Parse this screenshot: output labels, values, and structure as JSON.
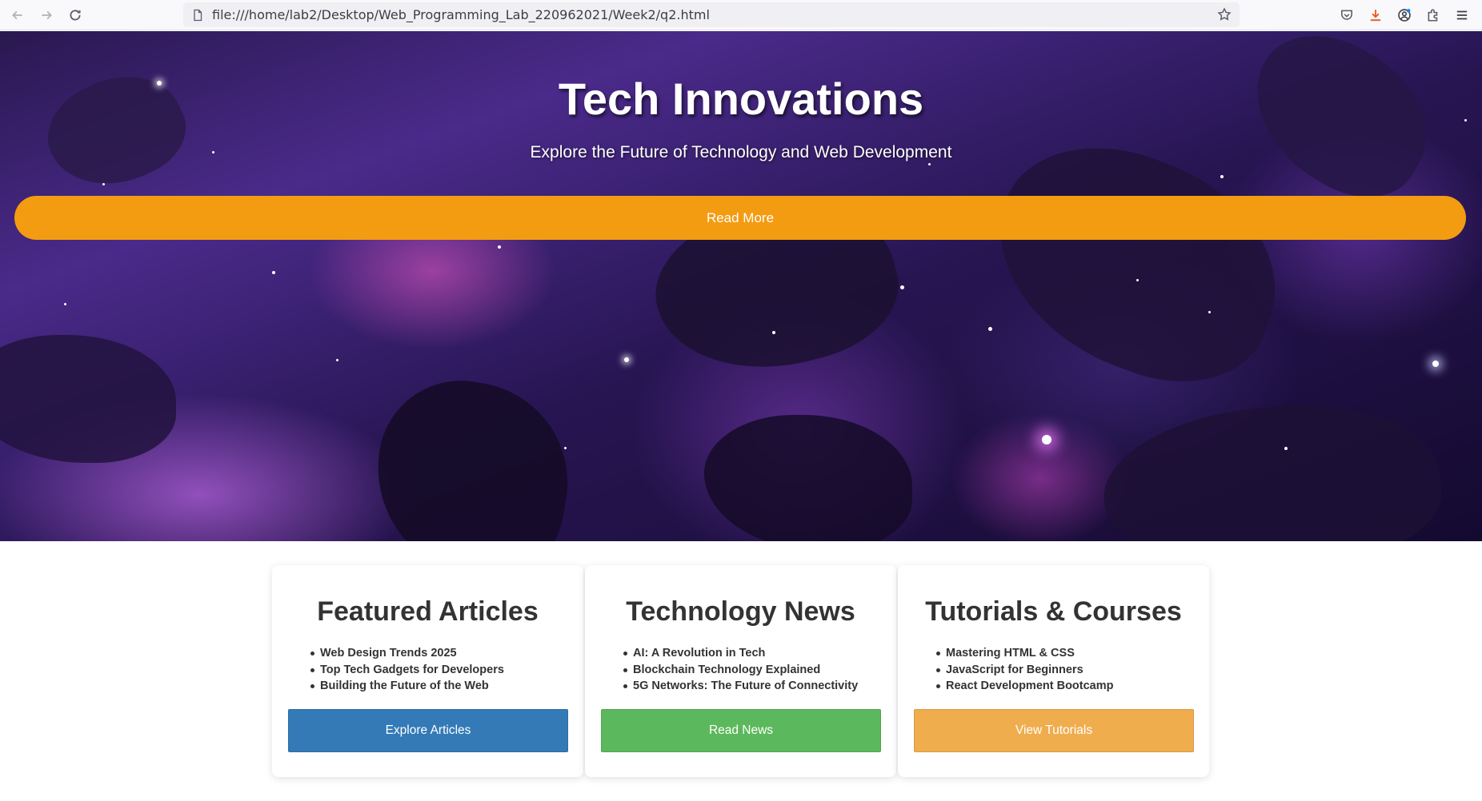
{
  "browser": {
    "url": "file:///home/lab2/Desktop/Web_Programming_Lab_220962021/Week2/q2.html"
  },
  "hero": {
    "title": "Tech Innovations",
    "subtitle": "Explore the Future of Technology and Web Development",
    "button_label": "Read More",
    "button_color": "#f39c12"
  },
  "cards": [
    {
      "title": "Featured Articles",
      "items": [
        "Web Design Trends 2025",
        "Top Tech Gadgets for Developers",
        "Building the Future of the Web"
      ],
      "button_label": "Explore Articles",
      "button_color": "#337ab7"
    },
    {
      "title": "Technology News",
      "items": [
        "AI: A Revolution in Tech",
        "Blockchain Technology Explained",
        "5G Networks: The Future of Connectivity"
      ],
      "button_label": "Read News",
      "button_color": "#5cb85c"
    },
    {
      "title": "Tutorials & Courses",
      "items": [
        "Mastering HTML & CSS",
        "JavaScript for Beginners",
        "React Development Bootcamp"
      ],
      "button_label": "View Tutorials",
      "button_color": "#f0ad4e"
    }
  ]
}
